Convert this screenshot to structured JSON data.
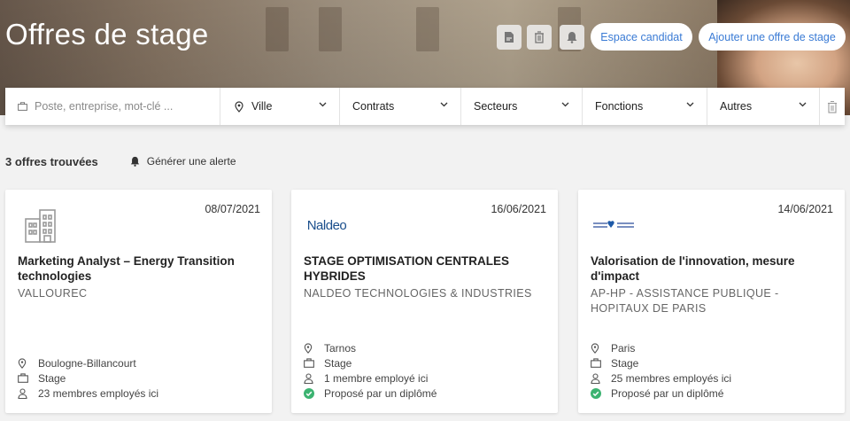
{
  "header": {
    "title": "Offres de stage",
    "icons": [
      "pdf-icon",
      "trash-icon",
      "bell-icon"
    ],
    "candidate_space_label": "Espace candidat",
    "add_offer_label": "Ajouter une offre de stage"
  },
  "search": {
    "placeholder": "Poste, entreprise, mot-clé ...",
    "city_label": "Ville",
    "contracts_label": "Contrats",
    "sectors_label": "Secteurs",
    "functions_label": "Fonctions",
    "others_label": "Autres"
  },
  "results": {
    "count_label": "3 offres trouvées",
    "alert_label": "Générer une alerte"
  },
  "offers": [
    {
      "date": "08/07/2021",
      "logo": "building-icon",
      "title": "Marketing Analyst – Energy Transition technologies",
      "company": "VALLOUREC",
      "location": "Boulogne-Billancourt",
      "contract": "Stage",
      "employees": "23 membres employés ici"
    },
    {
      "date": "16/06/2021",
      "logo_text": "Naldeo",
      "title": "STAGE OPTIMISATION CENTRALES HYBRIDES",
      "company": "NALDEO TECHNOLOGIES & INDUSTRIES",
      "location": "Tarnos",
      "contract": "Stage",
      "employees": "1 membre employé ici",
      "graduate": "Proposé par un diplômé"
    },
    {
      "date": "14/06/2021",
      "logo": "aphp-logo",
      "title": "Valorisation de l'innovation, mesure d'impact",
      "company": "AP-HP - ASSISTANCE PUBLIQUE - HOPITAUX DE PARIS",
      "location": "Paris",
      "contract": "Stage",
      "employees": "25 membres employés ici",
      "graduate": "Proposé par un diplômé"
    }
  ],
  "colors": {
    "accent": "#3a7bd5",
    "background": "#f2f2f2",
    "check": "#3cb371"
  }
}
